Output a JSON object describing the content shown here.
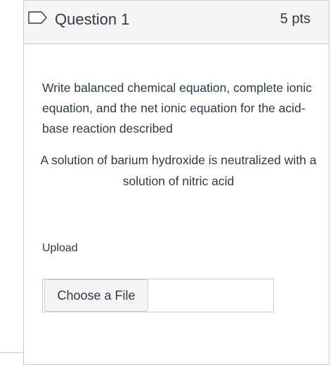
{
  "question": {
    "title": "Question 1",
    "points": "5 pts",
    "flag_icon": "bookmark-flag-icon",
    "prompt": "Write balanced chemical equation, complete ionic equation, and the net ionic equation for the acid-base reaction described",
    "scenario": "A solution of barium hydroxide is neutralized with a solution of nitric acid"
  },
  "upload": {
    "label": "Upload",
    "button_label": "Choose a File",
    "file_name": ""
  },
  "colors": {
    "header_bg": "#f5f5f5",
    "border": "#c7cdd1",
    "text": "#2d3b45"
  }
}
